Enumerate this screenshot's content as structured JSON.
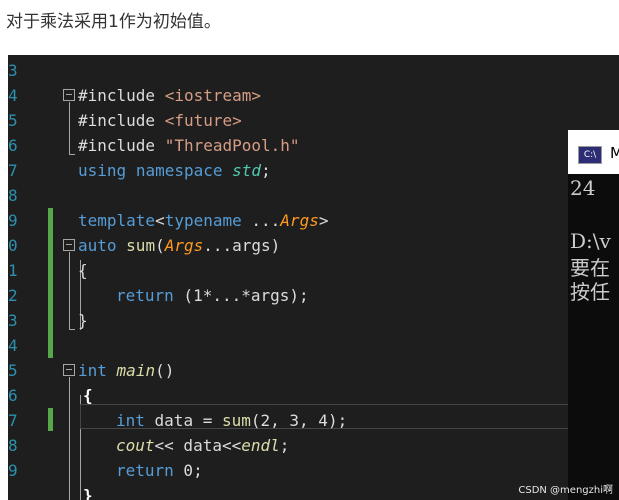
{
  "caption": "对于乘法采用1作为初始值。",
  "gutter_numbers": [
    "3",
    "4",
    "5",
    "6",
    "7",
    "8",
    "9",
    "0",
    "1",
    "2",
    "3",
    "4",
    "5",
    "6",
    "7",
    "8",
    "9"
  ],
  "code": {
    "l4_text": "#include ",
    "l4_header": "<iostream>",
    "l5_text": "#include ",
    "l5_header": "<future>",
    "l6_text": "#include ",
    "l6_header": "\"ThreadPool.h\"",
    "l7_using": "using",
    "l7_namespace": "namespace",
    "l7_std": "std",
    "l7_semi": ";",
    "l9_template": "template",
    "l9_lt": "<",
    "l9_typename": "typename",
    "l9_dots": " ...",
    "l9_args": "Args",
    "l9_gt": ">",
    "l10_auto": "auto",
    "l10_sum": "sum",
    "l10_open": "(",
    "l10_args": "Args",
    "l10_rest": "...args)",
    "l11_brace": "{",
    "l12_return": "return",
    "l12_expr": " (1*...*args);",
    "l13_brace": "}",
    "l15_int": "int",
    "l15_main": "main",
    "l15_parens": "()",
    "l16_brace": "{",
    "l17_int": "int",
    "l17_data": " data = ",
    "l17_sum": "sum",
    "l17_args": "(2, 3, 4);",
    "l18_cout": "cout",
    "l18_mid": "<< data<<",
    "l18_endl": "endl",
    "l18_semi": ";",
    "l19_return": "return",
    "l19_rest": " 0;",
    "l20_brace": "}"
  },
  "console": {
    "icon_label": "C:\\",
    "title": "M",
    "lines": [
      "24",
      "",
      "D:\\v",
      "要在",
      "按任"
    ]
  },
  "watermark": "CSDN @mengzhi啊",
  "colors": {
    "editor_bg": "#1e1e1e",
    "keyword": "#569cd6",
    "function": "#dcdcaa",
    "string": "#d69d85",
    "type_param": "#ff9a1f",
    "change_bar": "#57a64a"
  }
}
